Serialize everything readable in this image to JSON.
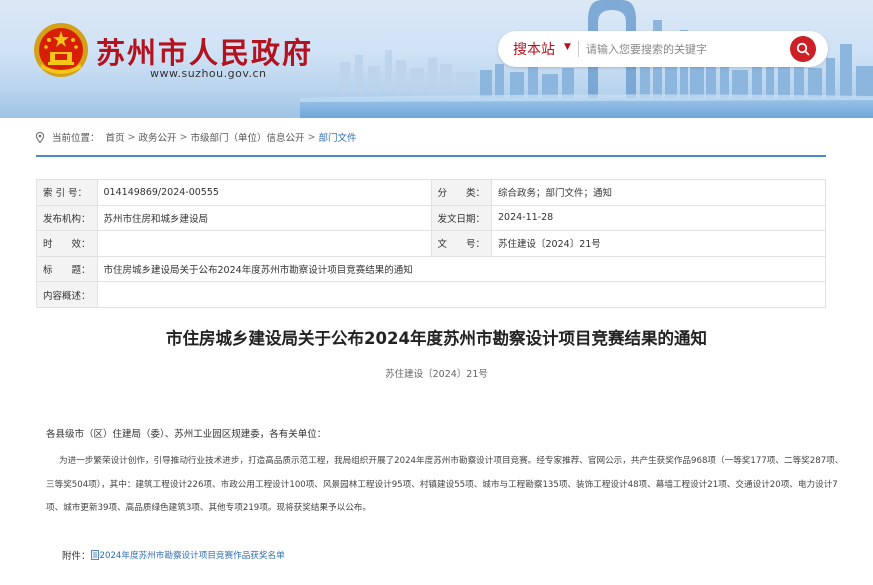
{
  "header": {
    "site_title": "苏州市人民政府",
    "site_url": "www.suzhou.gov.cn",
    "search": {
      "scope_label": "搜本站",
      "placeholder": "请输入您要搜索的关键字"
    }
  },
  "breadcrumb": {
    "prefix": "当前位置：",
    "items": [
      "首页",
      "政务公开",
      "市级部门（单位）信息公开",
      "部门文件"
    ],
    "separator": ">"
  },
  "info": {
    "index_label": "索 引 号：",
    "index_value": "014149869/2024-00555",
    "category_label": "分　　类：",
    "category_value": "综合政务；部门文件；通知",
    "publisher_label": "发布机构：",
    "publisher_value": "苏州市住房和城乡建设局",
    "date_label": "发文日期：",
    "date_value": "2024-11-28",
    "effect_label": "时　　效：",
    "effect_value": "",
    "docno_label": "文　　号：",
    "docno_value": "苏住建设〔2024〕21号",
    "title_label": "标　　题：",
    "title_value": "市住房城乡建设局关于公布2024年度苏州市勘察设计项目竞赛结果的通知",
    "summary_label": "内容概述：",
    "summary_value": ""
  },
  "article": {
    "title": "市住房城乡建设局关于公布2024年度苏州市勘察设计项目竞赛结果的通知",
    "doc_number": "苏住建设〔2024〕21号",
    "greeting": "各县级市（区）住建局（委）、苏州工业园区规建委，各有关单位：",
    "body_lines": [
      "为进一步繁荣设计创作，引导推动行业技术进步，打造高品质示范工程，我局组织开展了2024年度苏州市勘察设计项目竞赛。经专家推荐、官网公示，共产生获奖作品968项（一等奖177项、二等奖287项、",
      "三等奖504项），其中：建筑工程设计226项、市政公用工程设计100项、风景园林工程设计95项、村镇建设55项、城市与工程勘察135项、装饰工程设计48项、幕墙工程设计21项、交通设计20项、电力设计7",
      "项、城市更新39项、高品质绿色建筑3项、其他专项219项。现将获奖结果予以公布。"
    ],
    "attachment_label": "附件：",
    "attachment_link": "2024年度苏州市勘察设计项目竞赛作品获奖名单"
  },
  "colors": {
    "brand_red": "#b3121e",
    "link_blue": "#2f6db5",
    "rule_blue": "#4a89cd"
  },
  "icons": [
    "national-emblem-icon",
    "search-icon",
    "location-pin-icon",
    "document-icon",
    "dropdown-caret-icon"
  ]
}
